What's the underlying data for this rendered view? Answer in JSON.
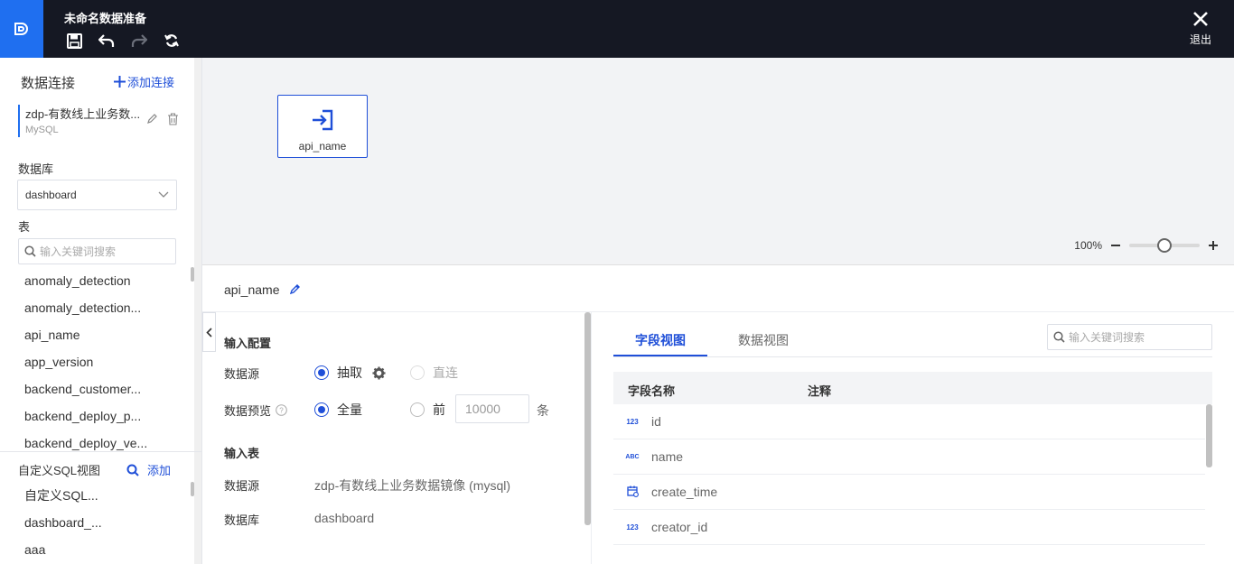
{
  "header": {
    "title": "未命名数据准备",
    "exit_label": "退出"
  },
  "sidebar": {
    "connections_title": "数据连接",
    "add_connection_label": "添加连接",
    "connection": {
      "name": "zdp-有数线上业务数...",
      "type": "MySQL"
    },
    "database_label": "数据库",
    "database_value": "dashboard",
    "table_label": "表",
    "search_placeholder": "输入关键词搜索",
    "tables": [
      "anomaly_detection",
      "anomaly_detection...",
      "api_name",
      "app_version",
      "backend_customer...",
      "backend_deploy_p...",
      "backend_deploy_ve..."
    ],
    "sql_view_title": "自定义SQL视图",
    "sql_add_label": "添加",
    "sql_views": [
      "自定义SQL...",
      "dashboard_...",
      "aaa"
    ]
  },
  "canvas": {
    "node_label": "api_name",
    "zoom_text": "100%",
    "zoom_level": 0.5
  },
  "detail": {
    "title": "api_name",
    "input_config_heading": "输入配置",
    "source_label": "数据源",
    "source_options": {
      "extract": "抽取",
      "direct": "直连"
    },
    "preview_label": "数据预览",
    "preview_options": {
      "all": "全量",
      "first": "前"
    },
    "preview_count": "10000",
    "preview_unit": "条",
    "input_table_heading": "输入表",
    "input_source_label": "数据源",
    "input_source_value": "zdp-有数线上业务数据镜像 (mysql)",
    "input_db_label": "数据库",
    "input_db_value": "dashboard"
  },
  "fields": {
    "tabs": [
      "字段视图",
      "数据视图"
    ],
    "search_placeholder": "输入关键词搜索",
    "columns": [
      "字段名称",
      "注释"
    ],
    "rows": [
      {
        "type": "123",
        "name": "id"
      },
      {
        "type": "ABC",
        "name": "name"
      },
      {
        "type": "date",
        "name": "create_time"
      },
      {
        "type": "123",
        "name": "creator_id"
      }
    ]
  },
  "colors": {
    "accent": "#1f4fd8",
    "topbar": "#151823",
    "logo": "#1f6ff0"
  }
}
